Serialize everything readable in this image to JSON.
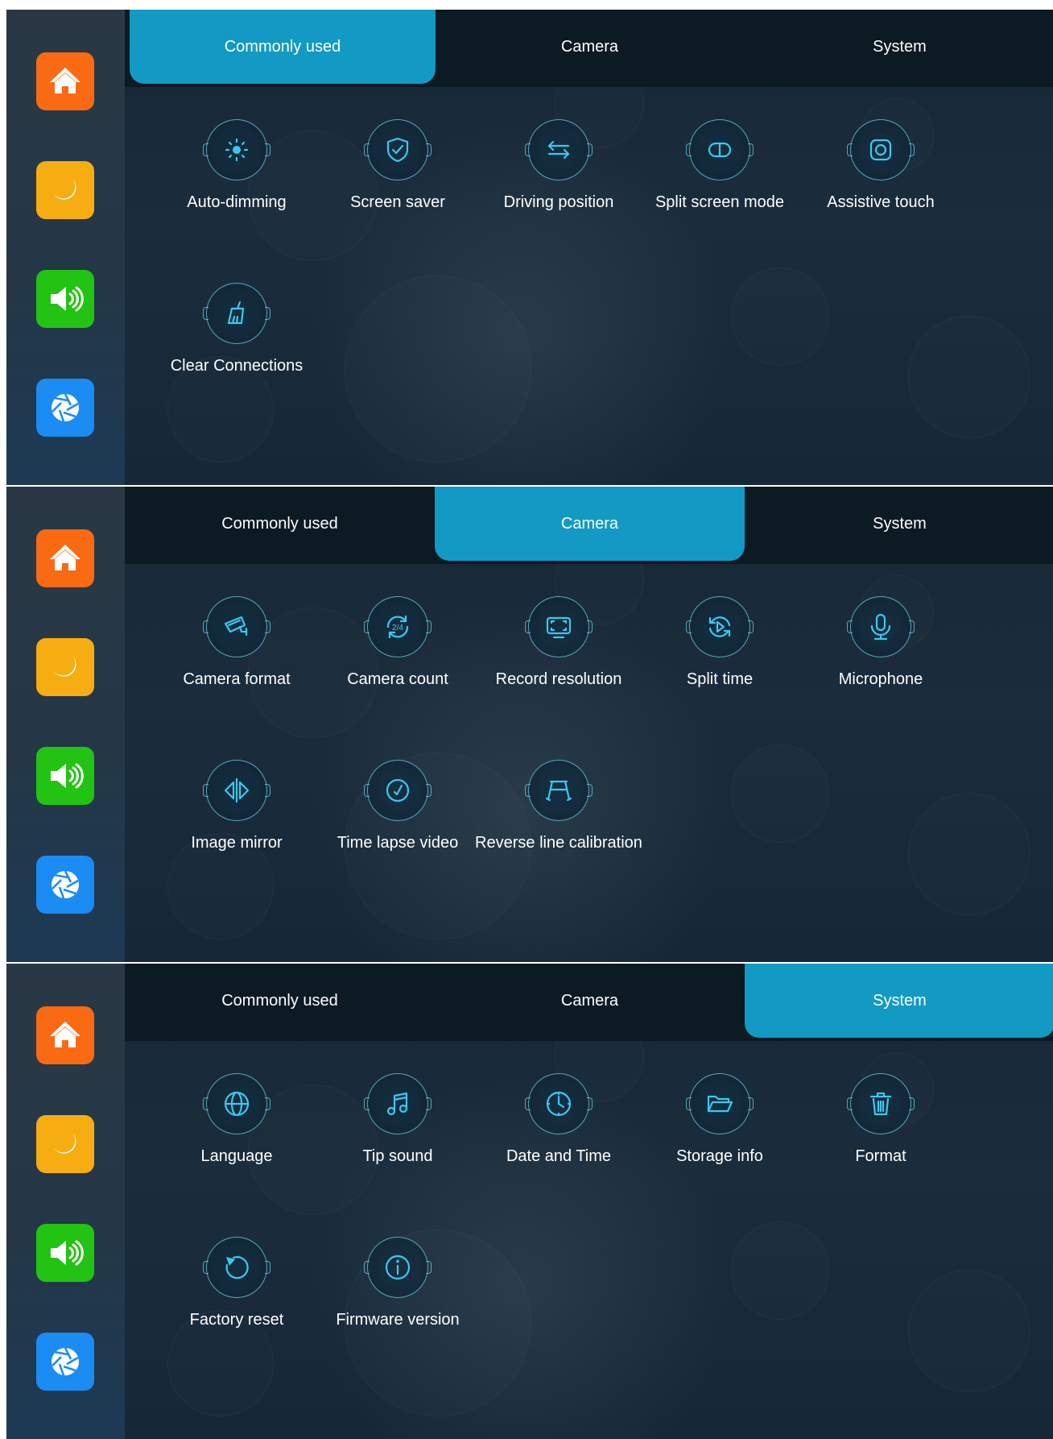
{
  "colors": {
    "tab_active": "#129ac4",
    "home": "#fa6a12",
    "night": "#f6ad12",
    "sound": "#23c313",
    "camera": "#1b8cf3",
    "icon_stroke": "#3cc8ee"
  },
  "sidebar": {
    "items": [
      {
        "icon": "home-icon",
        "color": "#fa6a12"
      },
      {
        "icon": "moon-icon",
        "color": "#f6ad12"
      },
      {
        "icon": "speaker-icon",
        "color": "#23c313"
      },
      {
        "icon": "aperture-icon",
        "color": "#1b8cf3"
      }
    ]
  },
  "tabs": [
    "Commonly used",
    "Camera",
    "System"
  ],
  "screens": [
    {
      "active_tab": "Commonly used",
      "items": [
        {
          "label": "Auto-dimming",
          "icon": "brightness-icon"
        },
        {
          "label": "Screen saver",
          "icon": "shield-check-icon"
        },
        {
          "label": "Driving position",
          "icon": "swap-arrows-icon"
        },
        {
          "label": "Split screen mode",
          "icon": "split-screen-icon"
        },
        {
          "label": "Assistive touch",
          "icon": "assistive-touch-icon"
        },
        {
          "label": "Clear Connections",
          "icon": "broom-icon"
        }
      ]
    },
    {
      "active_tab": "Camera",
      "items": [
        {
          "label": "Camera format",
          "icon": "cctv-icon"
        },
        {
          "label": "Camera count",
          "icon": "camera-count-icon",
          "badge": "2/4"
        },
        {
          "label": "Record resolution",
          "icon": "resolution-screen-icon"
        },
        {
          "label": "Split time",
          "icon": "play-cycle-icon"
        },
        {
          "label": "Microphone",
          "icon": "microphone-icon"
        },
        {
          "label": "Image mirror",
          "icon": "mirror-icon"
        },
        {
          "label": "Time lapse video",
          "icon": "stopwatch-icon"
        },
        {
          "label": "Reverse line calibration",
          "icon": "reverse-lines-icon"
        }
      ]
    },
    {
      "active_tab": "System",
      "items": [
        {
          "label": "Language",
          "icon": "globe-icon"
        },
        {
          "label": "Tip sound",
          "icon": "music-note-icon"
        },
        {
          "label": "Date and Time",
          "icon": "clock-icon"
        },
        {
          "label": "Storage info",
          "icon": "folder-icon"
        },
        {
          "label": "Format",
          "icon": "trash-icon"
        },
        {
          "label": "Factory reset",
          "icon": "reset-icon"
        },
        {
          "label": "Firmware version",
          "icon": "info-icon"
        }
      ]
    }
  ]
}
